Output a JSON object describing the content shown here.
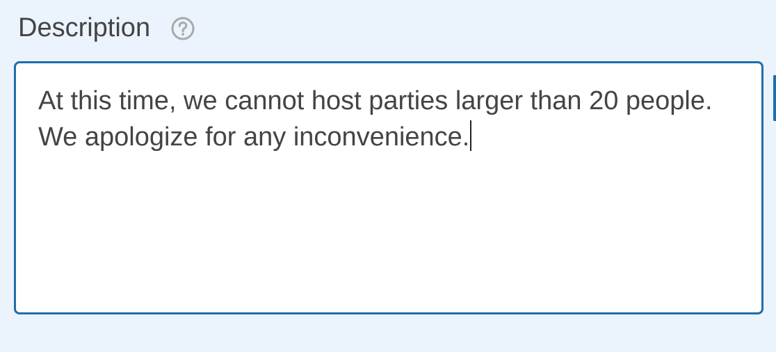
{
  "field": {
    "label": "Description",
    "help_icon": "question-circle-icon",
    "value": "At this time, we cannot host parties larger than 20 people. We apologize for any inconvenience."
  },
  "colors": {
    "background": "#ebf3fc",
    "label_text": "#444444",
    "help_icon": "#a9a9a9",
    "focus_border": "#1f6ea8",
    "textarea_bg": "#ffffff",
    "textarea_text": "#444444"
  }
}
